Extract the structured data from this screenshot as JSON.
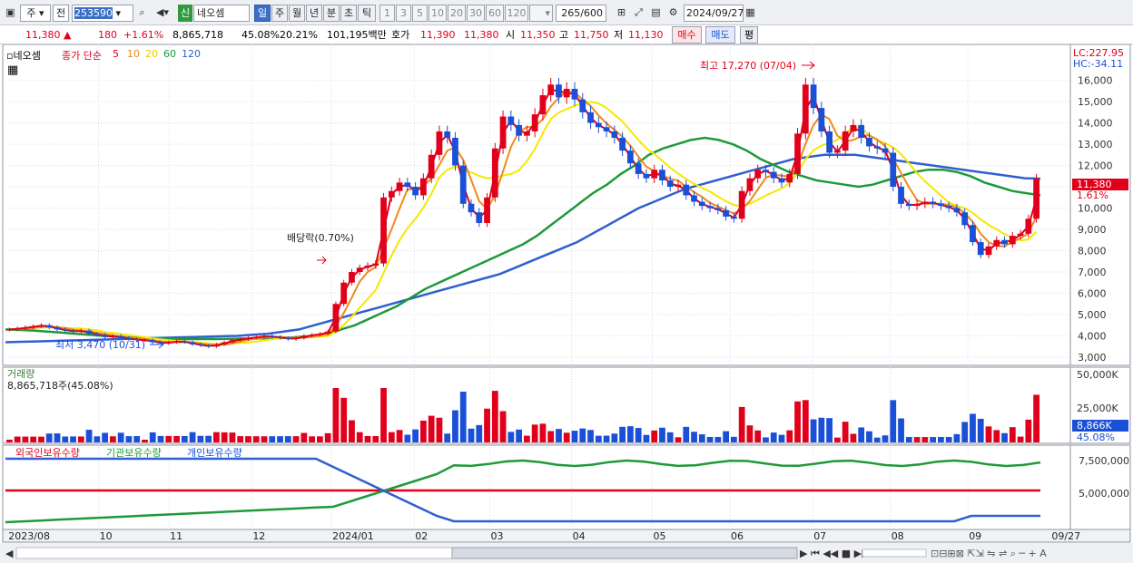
{
  "toolbar": {
    "period_label": "주",
    "prev_label": "전",
    "code": "253590",
    "badge": "신",
    "name": "네오셈",
    "tf": [
      "일",
      "주",
      "월",
      "년",
      "분",
      "초",
      "틱"
    ],
    "tf_selected": "일",
    "intervals": [
      "1",
      "3",
      "5",
      "10",
      "20",
      "30",
      "60",
      "120"
    ],
    "count": "265",
    "count_total": "/600",
    "date": "2024/09/27"
  },
  "info": {
    "price": "11,380",
    "change": "180",
    "pct": "+1.61%",
    "volume": "8,865,718",
    "vol_ratio": "45.08%",
    "turnover": "20.21%",
    "amount": "101,195백만",
    "ask_label": "호가",
    "ask": "11,390",
    "bid": "11,380",
    "open_label": "시",
    "open": "11,350",
    "high_label": "고",
    "high": "11,750",
    "low_label": "저",
    "low": "11,130",
    "buy": "매수",
    "sell": "매도",
    "avg": "평"
  },
  "legend": {
    "name": "네오셈",
    "price_type": "종가 단순",
    "ma": [
      "5",
      "10",
      "20",
      "60",
      "120"
    ],
    "lc": "LC:227.95",
    "hc": "HC:-34.11"
  },
  "annotations": {
    "high": "최고 17,270 (07/04)",
    "low": "최저 3,470 (10/31)",
    "dividend": "배당락(0.70%)"
  },
  "volume_panel": {
    "title": "거래량",
    "value": "8,865,718주(45.08%)",
    "ticks": [
      "50,000K",
      "25,000K"
    ],
    "last": "8,866K",
    "last_pct": "45.08%"
  },
  "holding_panel": {
    "foreign": "외국인보유수량",
    "inst": "기관보유수량",
    "indiv": "개인보유수량",
    "ticks": [
      "7,500,000",
      "5,000,000"
    ]
  },
  "price_tag": {
    "value": "11,380",
    "pct": "1.61%"
  },
  "colors": {
    "up": "#e0001b",
    "down": "#1a4fd8",
    "ma5": "#e0001b",
    "ma10": "#f08a1c",
    "ma20": "#f5e800",
    "ma60": "#1e9a3a",
    "ma120": "#2f5fd0"
  },
  "chart_data": {
    "type": "candlestick",
    "y_ticks": [
      3000,
      4000,
      5000,
      6000,
      7000,
      8000,
      9000,
      10000,
      11000,
      12000,
      13000,
      14000,
      15000,
      16000
    ],
    "ylim": [
      2700,
      17600
    ],
    "x_labels": [
      "2023/08",
      "10",
      "11",
      "12",
      "2024/01",
      "02",
      "03",
      "04",
      "05",
      "06",
      "07",
      "08",
      "09",
      "09/27"
    ],
    "closes": [
      4300,
      4350,
      4400,
      4450,
      4500,
      4400,
      4300,
      4250,
      4200,
      4250,
      4100,
      4050,
      3950,
      4000,
      3900,
      3850,
      3800,
      3800,
      3700,
      3650,
      3700,
      3750,
      3700,
      3600,
      3550,
      3500,
      3600,
      3700,
      3800,
      3850,
      3900,
      3950,
      4000,
      3950,
      3900,
      3850,
      3900,
      4000,
      4050,
      4100,
      4200,
      5500,
      6500,
      7000,
      7200,
      7300,
      7400,
      10500,
      10800,
      11200,
      11000,
      10600,
      11400,
      12500,
      13600,
      13300,
      12000,
      10200,
      9800,
      9300,
      10500,
      12800,
      14300,
      13900,
      13400,
      13600,
      14400,
      15300,
      15800,
      15200,
      15600,
      15100,
      14500,
      14000,
      13800,
      13600,
      13300,
      12700,
      12100,
      11600,
      11400,
      11800,
      11300,
      11000,
      11100,
      10600,
      10300,
      10100,
      10000,
      9900,
      9600,
      9500,
      10800,
      11400,
      11800,
      11700,
      11400,
      11200,
      11600,
      13500,
      15800,
      14700,
      13600,
      12600,
      12700,
      13600,
      13900,
      13300,
      12900,
      12800,
      12600,
      11000,
      10200,
      10100,
      10200,
      10300,
      10200,
      10100,
      10000,
      9800,
      9200,
      8400,
      7800,
      8200,
      8500,
      8300,
      8700,
      8800,
      9500,
      11380
    ],
    "ma60": [
      4300,
      4280,
      4250,
      4200,
      4150,
      4100,
      4050,
      4000,
      3960,
      3920,
      3900,
      3880,
      3860,
      3850,
      3850,
      3850,
      3860,
      3870,
      3880,
      3890,
      3900,
      3950,
      4000,
      4100,
      4300,
      4500,
      4800,
      5100,
      5400,
      5800,
      6200,
      6500,
      6800,
      7100,
      7400,
      7700,
      8000,
      8300,
      8700,
      9200,
      9700,
      10200,
      10700,
      11100,
      11600,
      12000,
      12500,
      12800,
      13000,
      13200,
      13300,
      13200,
      13000,
      12700,
      12300,
      12000,
      11700,
      11500,
      11300,
      11200,
      11100,
      11000,
      11100,
      11300,
      11500,
      11700,
      11800,
      11800,
      11700,
      11500,
      11200,
      11000,
      10800,
      10700,
      10600
    ],
    "ma120": [
      3700,
      3720,
      3740,
      3760,
      3780,
      3800,
      3820,
      3840,
      3860,
      3880,
      3900,
      3920,
      3940,
      3960,
      3980,
      4000,
      4050,
      4100,
      4200,
      4300,
      4500,
      4700,
      4900,
      5100,
      5300,
      5500,
      5700,
      5900,
      6100,
      6300,
      6500,
      6700,
      6900,
      7200,
      7500,
      7800,
      8100,
      8400,
      8800,
      9200,
      9600,
      10000,
      10300,
      10600,
      10900,
      11100,
      11300,
      11500,
      11700,
      11900,
      12100,
      12300,
      12400,
      12500,
      12500,
      12500,
      12400,
      12300,
      12200,
      12100,
      12000,
      11900,
      11800,
      11700,
      11600,
      11500,
      11400,
      11380
    ]
  }
}
